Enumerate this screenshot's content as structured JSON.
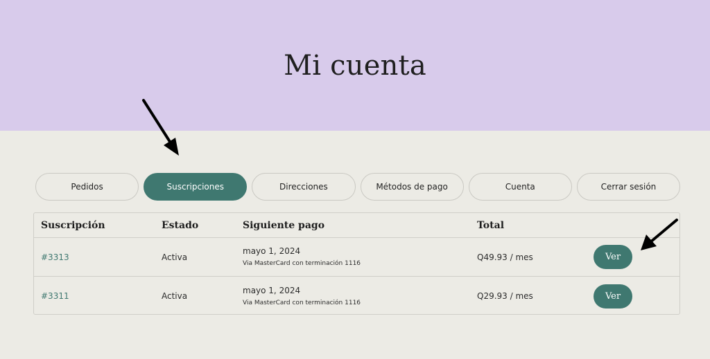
{
  "header": {
    "title": "Mi cuenta"
  },
  "tabs": [
    {
      "label": "Pedidos",
      "active": false
    },
    {
      "label": "Suscripciones",
      "active": true
    },
    {
      "label": "Direcciones",
      "active": false
    },
    {
      "label": "Métodos de pago",
      "active": false
    },
    {
      "label": "Cuenta",
      "active": false
    },
    {
      "label": "Cerrar sesión",
      "active": false
    }
  ],
  "table": {
    "headers": {
      "subscription": "Suscripción",
      "status": "Estado",
      "next_payment": "Siguiente pago",
      "total": "Total"
    },
    "rows": [
      {
        "id": "#3313",
        "status": "Activa",
        "next_date": "mayo 1, 2024",
        "payment_method": "Via MasterCard con terminación 1116",
        "total": "Q49.93 / mes",
        "action": "Ver"
      },
      {
        "id": "#3311",
        "status": "Activa",
        "next_date": "mayo 1, 2024",
        "payment_method": "Via MasterCard con terminación 1116",
        "total": "Q29.93 / mes",
        "action": "Ver"
      }
    ]
  },
  "colors": {
    "hero_bg": "#d8cbeb",
    "page_bg": "#ecebe5",
    "accent": "#3f7870",
    "arrow": "#000000"
  },
  "icons": [
    "arrow-pointer-icon",
    "arrow-pointer-icon"
  ]
}
